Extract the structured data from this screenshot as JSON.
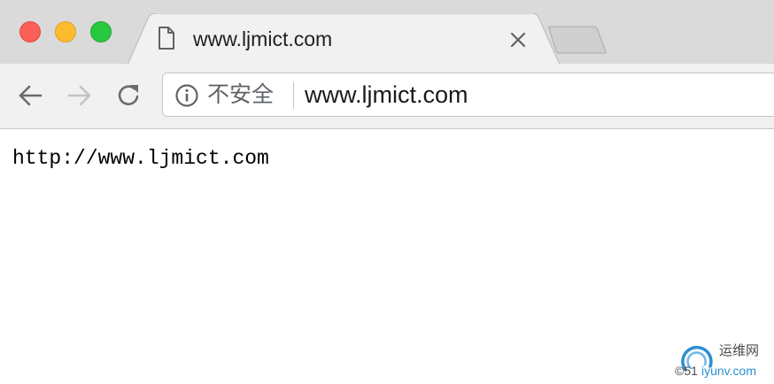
{
  "window": {
    "traffic_lights": [
      "close",
      "minimize",
      "maximize"
    ]
  },
  "tab": {
    "title": "www.ljmict.com",
    "icon": "document-icon"
  },
  "toolbar": {
    "security_label": "不安全",
    "url": "www.ljmict.com"
  },
  "page": {
    "text": "http://www.ljmict.com"
  },
  "watermark": {
    "chinese_text": "运维网",
    "copyright": "©51",
    "site": "iyunv.com"
  },
  "colors": {
    "close": "#fc5f57",
    "minimize": "#fdbc2e",
    "maximize": "#28c840",
    "tab_active": "#f1f1f1",
    "titlebar": "#dadada"
  }
}
